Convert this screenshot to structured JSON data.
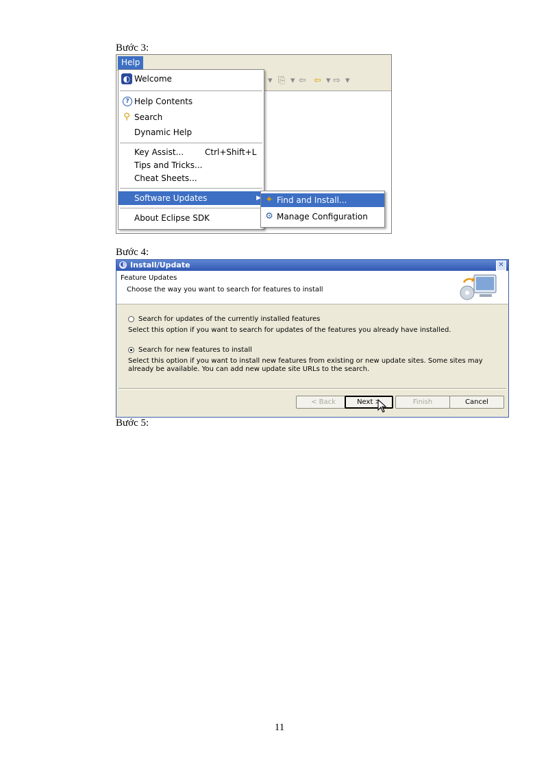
{
  "step3": "Bước 3:",
  "step4": "Bước 4:",
  "step5": "Bước 5:",
  "page_number": "11",
  "eclipse_menu": {
    "menubar_item": "Help",
    "items": [
      {
        "label": "Welcome",
        "icon": "welcome-icon"
      },
      {
        "label": "Help Contents",
        "icon": "help-contents-icon"
      },
      {
        "label": "Search",
        "icon": "search-icon"
      },
      {
        "label": "Dynamic Help"
      },
      {
        "label": "Key Assist...",
        "accelerator": "Ctrl+Shift+L"
      },
      {
        "label": "Tips and Tricks..."
      },
      {
        "label": "Cheat Sheets..."
      },
      {
        "label": "Software Updates",
        "selected": true,
        "has_submenu": true
      },
      {
        "label": "About Eclipse SDK"
      }
    ],
    "submenu": [
      {
        "label": "Find and Install...",
        "icon": "find-install-icon",
        "selected": true
      },
      {
        "label": "Manage Configuration",
        "icon": "manage-configuration-icon"
      }
    ],
    "selection_color": "#3d6fc4"
  },
  "install_dialog": {
    "title": "Install/Update",
    "header_title": "Feature Updates",
    "header_subtitle": "Choose the way you want to search for features to install",
    "option1_label": "Search for updates of the currently installed features",
    "option1_desc": "Select this option if you want to search for updates of the features you already have installed.",
    "option2_label": "Search for new features to install",
    "option2_desc": "Select this option if you want to install new features from existing or new update sites. Some sites may already be available. You can add new update site URLs to the search.",
    "selected_option": 2,
    "buttons": {
      "back": "< Back",
      "next": "Next >",
      "finish": "Finish",
      "cancel": "Cancel"
    },
    "titlebar_color": "#3158b3"
  }
}
